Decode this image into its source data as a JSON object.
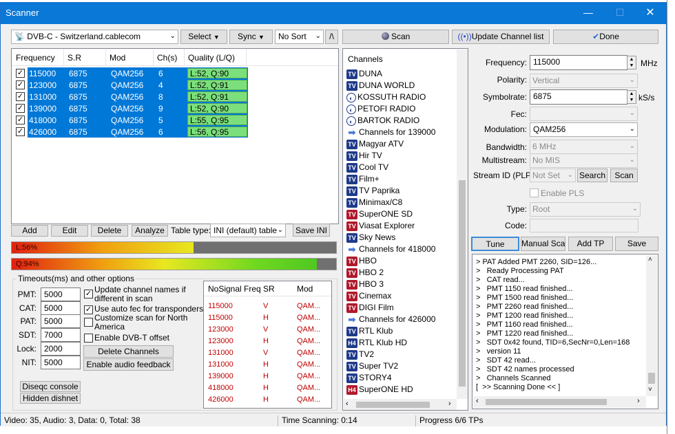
{
  "window": {
    "title": "Scanner",
    "minimize": "—",
    "maximize": "☐",
    "close": "✕"
  },
  "toolbar": {
    "source": "DVB-C - Switzerland.cablecom",
    "select": "Select",
    "sync": "Sync",
    "sort": "No Sort",
    "sort_toggle": "/\\",
    "scan": "Scan",
    "update": "Update Channel list",
    "done": "Done"
  },
  "tp_table": {
    "headers": [
      "Frequency",
      "S.R",
      "Mod",
      "Ch(s)",
      "Quality (L/Q)"
    ],
    "rows": [
      {
        "freq": "115000",
        "sr": "6875",
        "mod": "QAM256",
        "ch": "6",
        "q": "L:52, Q:90"
      },
      {
        "freq": "123000",
        "sr": "6875",
        "mod": "QAM256",
        "ch": "4",
        "q": "L:52, Q:91"
      },
      {
        "freq": "131000",
        "sr": "6875",
        "mod": "QAM256",
        "ch": "8",
        "q": "L:52, Q:91"
      },
      {
        "freq": "139000",
        "sr": "6875",
        "mod": "QAM256",
        "ch": "9",
        "q": "L:52, Q:90"
      },
      {
        "freq": "418000",
        "sr": "6875",
        "mod": "QAM256",
        "ch": "5",
        "q": "L:55, Q:95"
      },
      {
        "freq": "426000",
        "sr": "6875",
        "mod": "QAM256",
        "ch": "6",
        "q": "L:56, Q:95"
      }
    ]
  },
  "table_buttons": {
    "add": "Add",
    "edit": "Edit",
    "delete": "Delete",
    "analyze": "Analyze",
    "table_type_label": "Table type:",
    "table_type": "INI (default) table",
    "save_ini": "Save INI"
  },
  "level": {
    "label": "L:56%",
    "value": 0.56
  },
  "quality": {
    "label": "Q:94%",
    "value": 0.94
  },
  "timeouts": {
    "title": "Timeouts(ms) and other options",
    "fields": [
      {
        "label": "PMT:",
        "value": "5000"
      },
      {
        "label": "CAT:",
        "value": "5000"
      },
      {
        "label": "PAT:",
        "value": "5000"
      },
      {
        "label": "SDT:",
        "value": "7000"
      },
      {
        "label": "Lock:",
        "value": "2000"
      },
      {
        "label": "NIT:",
        "value": "5000"
      }
    ],
    "opt1": "Update channel names if different in scan",
    "opt2": "Use auto fec for transponders",
    "opt3": "Customize scan for North America",
    "opt4": "Enable DVB-T offset",
    "delete_channels": "Delete Channels",
    "audio_feedback": "Enable audio feedback",
    "diseqc": "Diseqc console",
    "hidden": "Hidden dishnet"
  },
  "nosignal": {
    "headers": [
      "NoSignal Freq",
      "SR",
      "Mod"
    ],
    "rows": [
      {
        "f": "115000",
        "sr": "V",
        "m": "QAM..."
      },
      {
        "f": "115000",
        "sr": "H",
        "m": "QAM..."
      },
      {
        "f": "123000",
        "sr": "V",
        "m": "QAM..."
      },
      {
        "f": "123000",
        "sr": "H",
        "m": "QAM..."
      },
      {
        "f": "131000",
        "sr": "V",
        "m": "QAM..."
      },
      {
        "f": "131000",
        "sr": "H",
        "m": "QAM..."
      },
      {
        "f": "139000",
        "sr": "H",
        "m": "QAM..."
      },
      {
        "f": "418000",
        "sr": "H",
        "m": "QAM..."
      },
      {
        "f": "426000",
        "sr": "H",
        "m": "QAM..."
      }
    ]
  },
  "channels": {
    "header": "Channels",
    "items": [
      {
        "icon": "tv",
        "name": "DUNA"
      },
      {
        "icon": "tv",
        "name": "DUNA WORLD"
      },
      {
        "icon": "radio",
        "name": "KOSSUTH RADIO"
      },
      {
        "icon": "radio",
        "name": "PETOFI RADIO"
      },
      {
        "icon": "radio",
        "name": "BARTOK RADIO"
      },
      {
        "icon": "arrow",
        "name": "Channels for 139000"
      },
      {
        "icon": "tv",
        "name": "Magyar ATV"
      },
      {
        "icon": "tv",
        "name": "Hir TV"
      },
      {
        "icon": "tv",
        "name": "Cool TV"
      },
      {
        "icon": "tv",
        "name": "Film+"
      },
      {
        "icon": "tv",
        "name": "TV Paprika"
      },
      {
        "icon": "tv",
        "name": "Minimax/C8"
      },
      {
        "icon": "tvr",
        "name": "SuperONE SD"
      },
      {
        "icon": "tvr",
        "name": "Viasat Explorer"
      },
      {
        "icon": "tv",
        "name": "Sky News"
      },
      {
        "icon": "arrow",
        "name": "Channels for 418000"
      },
      {
        "icon": "tvr",
        "name": "HBO"
      },
      {
        "icon": "tvr",
        "name": "HBO 2"
      },
      {
        "icon": "tvr",
        "name": "HBO 3"
      },
      {
        "icon": "tvr",
        "name": "Cinemax"
      },
      {
        "icon": "tvr",
        "name": "DIGI Film"
      },
      {
        "icon": "arrow",
        "name": "Channels for 426000"
      },
      {
        "icon": "tv",
        "name": "RTL Klub"
      },
      {
        "icon": "h4",
        "name": "RTL Klub HD"
      },
      {
        "icon": "tv",
        "name": "TV2"
      },
      {
        "icon": "tv",
        "name": "Super TV2"
      },
      {
        "icon": "tv",
        "name": "STORY4"
      },
      {
        "icon": "h4r",
        "name": "SuperONE HD"
      }
    ]
  },
  "tuner": {
    "frequency_label": "Frequency:",
    "frequency": "115000",
    "mhz": "MHz",
    "polarity_label": "Polarity:",
    "polarity": "Vertical",
    "symbolrate_label": "Symbolrate:",
    "symbolrate": "6875",
    "ks": "kS/s",
    "fec_label": "Fec:",
    "fec": "",
    "modulation_label": "Modulation:",
    "modulation": "QAM256",
    "bandwidth_label": "Bandwidth:",
    "bandwidth": "6 MHz",
    "multistream_label": "Multistream:",
    "multistream": "No MIS",
    "stream_label": "Stream ID (PLP):",
    "stream": "Not Set",
    "search": "Search",
    "scan": "Scan",
    "enable_pls": "Enable PLS",
    "type_label": "Type:",
    "type": "Root",
    "code_label": "Code:",
    "tune": "Tune",
    "manual_scan": "Manual Scan",
    "add_tp": "Add TP",
    "save": "Save"
  },
  "log": [
    "> PAT Added PMT 2260, SID=126...",
    ">   Ready Processing PAT",
    ">   CAT read...",
    ">   PMT 1150 read finished...",
    ">   PMT 1500 read finished...",
    ">   PMT 2260 read finished...",
    ">   PMT 1200 read finished...",
    ">   PMT 1160 read finished...",
    ">   PMT 1220 read finished...",
    ">   SDT 0x42 found, TID=6,SecNr=0,Len=168",
    ">   version 11",
    ">   SDT 42 read...",
    ">   SDT 42 names processed",
    ">   Channels Scanned",
    "[  >> Scanning Done << ]"
  ],
  "status": {
    "counts": "Video: 35, Audio: 3, Data: 0, Total: 38",
    "time": "Time Scanning: 0:14",
    "progress": "Progress 6/6 TPs"
  }
}
